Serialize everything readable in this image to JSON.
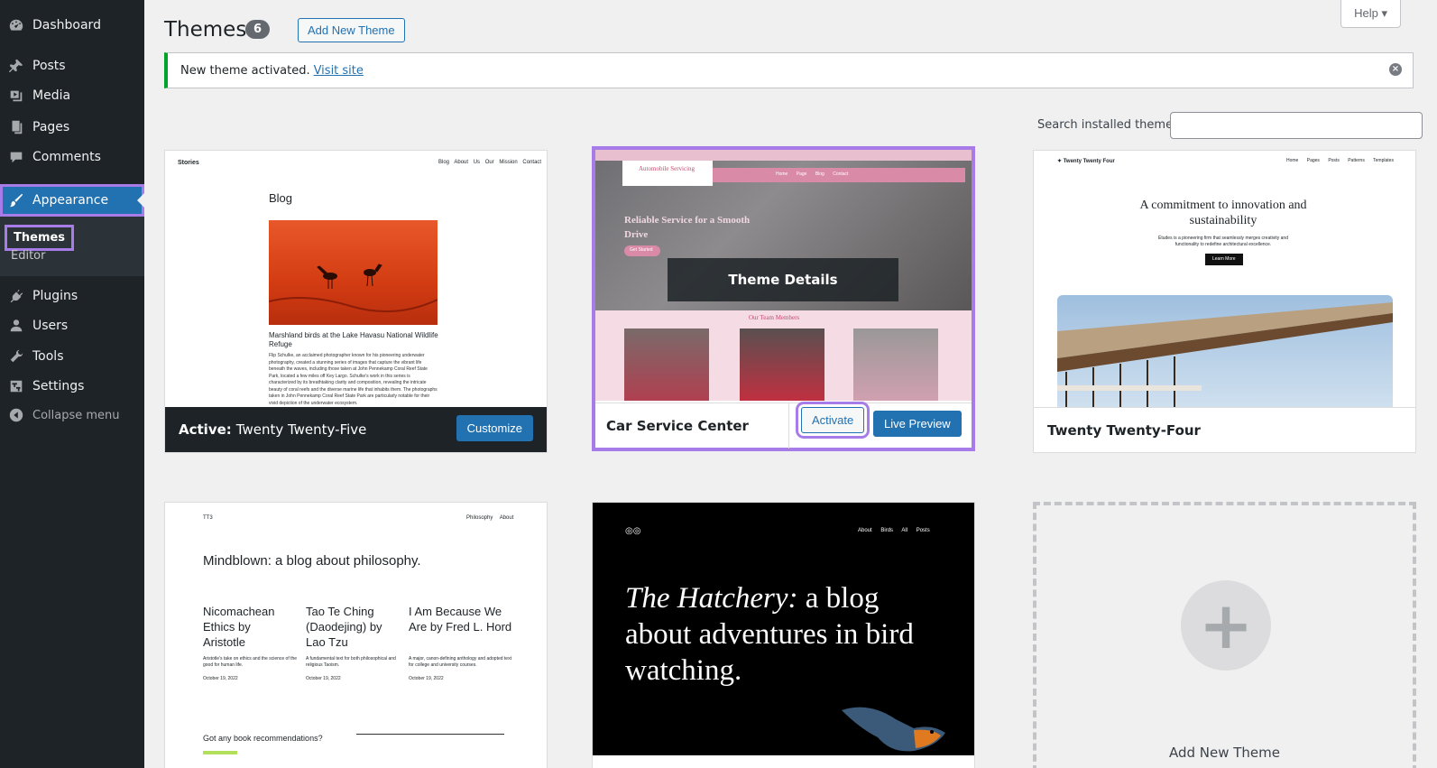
{
  "sidebar": {
    "items": [
      {
        "label": "Dashboard",
        "icon": "dashboard-icon"
      },
      {
        "label": "Posts",
        "icon": "pin-icon"
      },
      {
        "label": "Media",
        "icon": "media-icon"
      },
      {
        "label": "Pages",
        "icon": "pages-icon"
      },
      {
        "label": "Comments",
        "icon": "comment-icon"
      },
      {
        "label": "Appearance",
        "icon": "brush-icon"
      },
      {
        "label": "Plugins",
        "icon": "plugin-icon"
      },
      {
        "label": "Users",
        "icon": "user-icon"
      },
      {
        "label": "Tools",
        "icon": "wrench-icon"
      },
      {
        "label": "Settings",
        "icon": "settings-icon"
      },
      {
        "label": "Collapse menu",
        "icon": "collapse-icon"
      }
    ],
    "submenu": {
      "themes": "Themes",
      "editor": "Editor"
    }
  },
  "header": {
    "title": "Themes",
    "count": "6",
    "add_new": "Add New Theme",
    "help": "Help"
  },
  "notice": {
    "text": "New theme activated.",
    "link": "Visit site"
  },
  "search": {
    "label": "Search installed themes",
    "value": ""
  },
  "themes": {
    "active": {
      "prefix": "Active:",
      "name": "Twenty Twenty-Five",
      "action": "Customize",
      "preview": {
        "site": "Stories",
        "nav": [
          "Blog",
          "About Us",
          "Our Mission",
          "Contact"
        ],
        "heading": "Blog",
        "caption": "Marshland birds at the Lake Havasu National Wildlife Refuge",
        "body": "Flip Schulke, an acclaimed photographer known for his pioneering underwater photography, created a stunning series of images that capture the vibrant life beneath the waves, including those taken at John Pennekamp Coral Reef State Park, located a few miles off Key Largo. Schulke's work in this series is characterized by its breathtaking clarity and composition, revealing the intricate beauty of coral reefs and the diverse marine life that inhabits them. The photographs taken in John Pennekamp Coral Reef State Park are particularly notable for their vivid depiction of the underwater ecosystem."
      }
    },
    "car": {
      "name": "Car Service Center",
      "activate": "Activate",
      "live_preview": "Live Preview",
      "overlay": "Theme Details",
      "preview": {
        "brand": "Automobile Servicing",
        "hero": "Reliable Service for a Smooth Drive",
        "cta": "Get Started",
        "team": "Our Team Members",
        "nav": [
          "Home",
          "Page",
          "Blog",
          "Contact"
        ]
      }
    },
    "tt4": {
      "name": "Twenty Twenty-Four",
      "preview": {
        "site": "Twenty Twenty Four",
        "nav": [
          "Home",
          "Pages",
          "Posts",
          "Patterns",
          "Templates"
        ],
        "heading": "A commitment to innovation and sustainability",
        "sub": "Études is a pioneering firm that seamlessly merges creativity and functionality to redefine architectural excellence.",
        "cta": "Learn More"
      }
    },
    "tt3": {
      "preview": {
        "site": "TT3",
        "nav": [
          "Philosophy",
          "About"
        ],
        "heading": "Mindblown: a blog about philosophy.",
        "posts": [
          {
            "title": "Nicomachean Ethics by Aristotle",
            "desc": "Aristotle's take on ethics and the science of the good for human life.",
            "date": "October 19, 2022"
          },
          {
            "title": "Tao Te Ching (Daodejing) by Lao Tzu",
            "desc": "A fundamental text for both philosophical and religious Taoism.",
            "date": "October 19, 2022"
          },
          {
            "title": "I Am Because We Are by Fred L. Hord",
            "desc": "A major, canon-defining anthology and adopted text for college and university courses.",
            "date": "October 19, 2022"
          }
        ],
        "footer_q": "Got any book recommendations?"
      }
    },
    "hatchery": {
      "preview": {
        "nav": [
          "About",
          "Birds",
          "All Posts"
        ],
        "heading_em": "The Hatchery:",
        "heading": "a blog about adventures in bird watching."
      }
    },
    "add_new": {
      "label": "Add New Theme"
    }
  },
  "colors": {
    "accent": "#2271b1",
    "highlight": "#a77ce8",
    "sidebar": "#1d2327",
    "success": "#00a32a"
  }
}
